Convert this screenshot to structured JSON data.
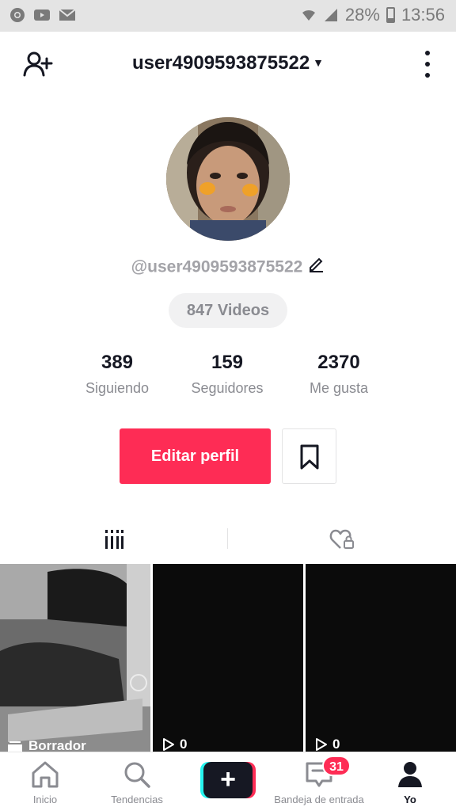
{
  "status_bar": {
    "battery": "28%",
    "time": "13:56",
    "icons": [
      "chrome-icon",
      "youtube-icon",
      "mail-icon",
      "wifi-icon",
      "signal-icon",
      "battery-icon"
    ]
  },
  "header": {
    "username": "user4909593875522"
  },
  "profile": {
    "handle": "@user4909593875522",
    "videos_label": "847 Videos"
  },
  "stats": [
    {
      "value": "389",
      "label": "Siguiendo"
    },
    {
      "value": "159",
      "label": "Seguidores"
    },
    {
      "value": "2370",
      "label": "Me gusta"
    }
  ],
  "actions": {
    "edit_profile": "Editar perfil"
  },
  "grid": {
    "items": [
      {
        "type": "draft",
        "label": "Borrador"
      },
      {
        "type": "video",
        "views": "0"
      },
      {
        "type": "video",
        "views": "0"
      }
    ]
  },
  "nav": {
    "items": [
      {
        "label": "Inicio",
        "icon": "home-icon"
      },
      {
        "label": "Tendencias",
        "icon": "search-icon"
      },
      {
        "label": "",
        "icon": "plus-icon"
      },
      {
        "label": "Bandeja de entrada",
        "icon": "inbox-icon"
      },
      {
        "label": "Yo",
        "icon": "profile-icon"
      }
    ],
    "inbox_badge": "31"
  },
  "colors": {
    "accent": "#fe2c55",
    "cyan": "#25f4ee",
    "text": "#161823",
    "muted": "#8a8b91"
  }
}
